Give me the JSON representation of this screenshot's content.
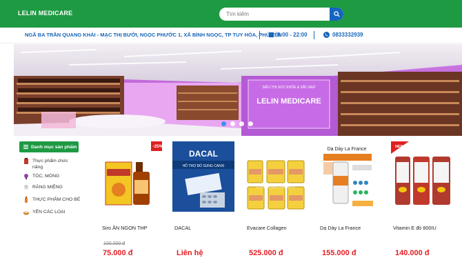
{
  "header": {
    "logo_text": "LELIN MEDICARE",
    "search_placeholder": "Tìm kiếm"
  },
  "infobar": {
    "address": "NGÃ BA TRẦN QUANG KHẢI - MẠC THỊ BƯỞI, NGỌC PHƯỚC 1, XÃ BÌNH NGỌC, TP TUY HÒA, PHÚ YÊN",
    "hours": "8:00 - 22:00",
    "phone": "0833332939"
  },
  "banner": {
    "sign_top": "SIÊU THỊ SỨC KHỎE & SẮC ĐẸP",
    "sign_main": "LELIN MEDICARE",
    "slides_count": 4,
    "active_slide": 1
  },
  "sidebar": {
    "category_button": "Danh mục sản phẩm",
    "items": [
      {
        "label": "Thực phẩm chức năng",
        "icon": "supplement-icon"
      },
      {
        "label": "TÓC, MÓNG",
        "icon": "hair-icon"
      },
      {
        "label": "RĂNG MIỆNG",
        "icon": "tooth-icon"
      },
      {
        "label": "THỰC PHẨM CHO BÉ",
        "icon": "baby-food-icon"
      },
      {
        "label": "YẾN CÁC LOẠI",
        "icon": "bird-nest-icon"
      }
    ]
  },
  "products": [
    {
      "name": "Siro ĂN NGON THP",
      "old_price": "100.000 đ",
      "price": "75.000 đ",
      "badge": "-25%"
    },
    {
      "name": "DACAL",
      "old_price": "",
      "price": "Liên hệ",
      "badge": "",
      "pack_title": "DACAL",
      "pack_sub": "HỖ TRỢ BỔ SUNG CANXI"
    },
    {
      "name": "Evacare Collagen",
      "old_price": "",
      "price": "525.000 đ",
      "badge": "",
      "watermark": "LelinMedicare"
    },
    {
      "name": "Dạ Dày La France",
      "old_price": "",
      "price": "155.000 đ",
      "badge": "",
      "pack_title": "Dạ Dày La France"
    },
    {
      "name": "Vitamin E đỏ 800IU",
      "old_price": "",
      "price": "140.000 đ",
      "badge": "NEW"
    }
  ],
  "colors": {
    "brand_green": "#1e9a43",
    "brand_blue": "#1665b8",
    "price_red": "#e31e24"
  }
}
